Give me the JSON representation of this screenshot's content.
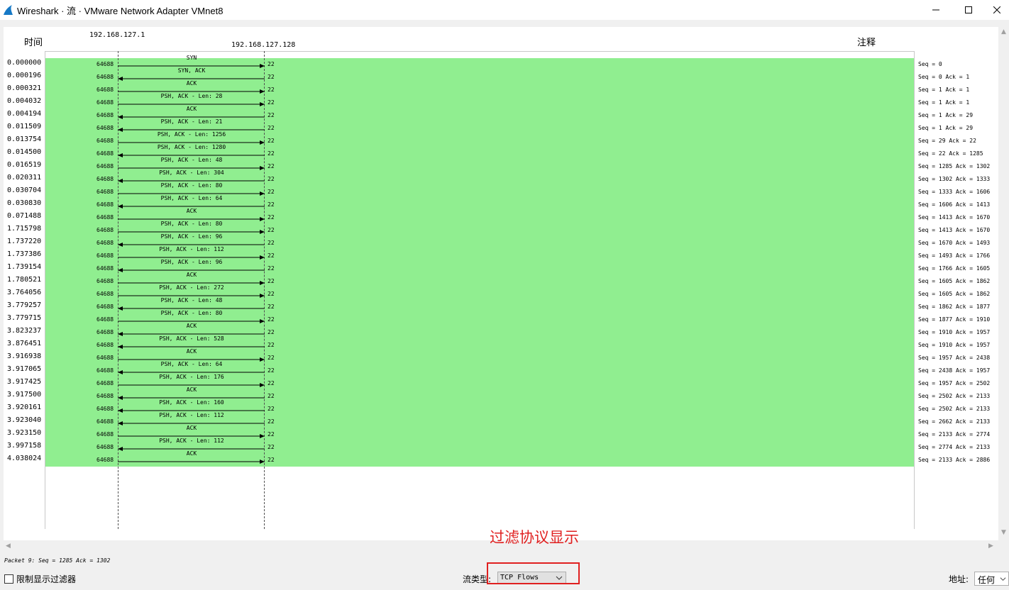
{
  "window": {
    "title": "Wireshark · 流 · VMware Network Adapter VMnet8",
    "icon": "wireshark-shark-fin-icon",
    "controls": [
      "minimize-icon",
      "maximize-icon",
      "close-icon"
    ]
  },
  "headers": {
    "time": "时间",
    "host1": "192.168.127.1",
    "host2": "192.168.127.128",
    "comment": "注释"
  },
  "colors": {
    "flow_fill": "#90ee90",
    "annotation": "#e02020"
  },
  "rows": [
    {
      "time": "0.000000",
      "src_port": "64688",
      "dst_port": "22",
      "label": "SYN",
      "direction": "right",
      "comment": "Seq = 0"
    },
    {
      "time": "0.000196",
      "src_port": "64688",
      "dst_port": "22",
      "label": "SYN, ACK",
      "direction": "left",
      "comment": "Seq = 0 Ack = 1"
    },
    {
      "time": "0.000321",
      "src_port": "64688",
      "dst_port": "22",
      "label": "ACK",
      "direction": "right",
      "comment": "Seq = 1 Ack = 1"
    },
    {
      "time": "0.004032",
      "src_port": "64688",
      "dst_port": "22",
      "label": "PSH, ACK - Len: 28",
      "direction": "right",
      "comment": "Seq = 1 Ack = 1"
    },
    {
      "time": "0.004194",
      "src_port": "64688",
      "dst_port": "22",
      "label": "ACK",
      "direction": "left",
      "comment": "Seq = 1 Ack = 29"
    },
    {
      "time": "0.011509",
      "src_port": "64688",
      "dst_port": "22",
      "label": "PSH, ACK - Len: 21",
      "direction": "left",
      "comment": "Seq = 1 Ack = 29"
    },
    {
      "time": "0.013754",
      "src_port": "64688",
      "dst_port": "22",
      "label": "PSH, ACK - Len: 1256",
      "direction": "right",
      "comment": "Seq = 29 Ack = 22"
    },
    {
      "time": "0.014500",
      "src_port": "64688",
      "dst_port": "22",
      "label": "PSH, ACK - Len: 1280",
      "direction": "left",
      "comment": "Seq = 22 Ack = 1285"
    },
    {
      "time": "0.016519",
      "src_port": "64688",
      "dst_port": "22",
      "label": "PSH, ACK - Len: 48",
      "direction": "right",
      "comment": "Seq = 1285 Ack = 1302"
    },
    {
      "time": "0.020311",
      "src_port": "64688",
      "dst_port": "22",
      "label": "PSH, ACK - Len: 304",
      "direction": "left",
      "comment": "Seq = 1302 Ack = 1333"
    },
    {
      "time": "0.030704",
      "src_port": "64688",
      "dst_port": "22",
      "label": "PSH, ACK - Len: 80",
      "direction": "right",
      "comment": "Seq = 1333 Ack = 1606"
    },
    {
      "time": "0.030830",
      "src_port": "64688",
      "dst_port": "22",
      "label": "PSH, ACK - Len: 64",
      "direction": "left",
      "comment": "Seq = 1606 Ack = 1413"
    },
    {
      "time": "0.071488",
      "src_port": "64688",
      "dst_port": "22",
      "label": "ACK",
      "direction": "right",
      "comment": "Seq = 1413 Ack = 1670"
    },
    {
      "time": "1.715798",
      "src_port": "64688",
      "dst_port": "22",
      "label": "PSH, ACK - Len: 80",
      "direction": "right",
      "comment": "Seq = 1413 Ack = 1670"
    },
    {
      "time": "1.737220",
      "src_port": "64688",
      "dst_port": "22",
      "label": "PSH, ACK - Len: 96",
      "direction": "left",
      "comment": "Seq = 1670 Ack = 1493"
    },
    {
      "time": "1.737386",
      "src_port": "64688",
      "dst_port": "22",
      "label": "PSH, ACK - Len: 112",
      "direction": "right",
      "comment": "Seq = 1493 Ack = 1766"
    },
    {
      "time": "1.739154",
      "src_port": "64688",
      "dst_port": "22",
      "label": "PSH, ACK - Len: 96",
      "direction": "left",
      "comment": "Seq = 1766 Ack = 1605"
    },
    {
      "time": "1.780521",
      "src_port": "64688",
      "dst_port": "22",
      "label": "ACK",
      "direction": "right",
      "comment": "Seq = 1605 Ack = 1862"
    },
    {
      "time": "3.764056",
      "src_port": "64688",
      "dst_port": "22",
      "label": "PSH, ACK - Len: 272",
      "direction": "right",
      "comment": "Seq = 1605 Ack = 1862"
    },
    {
      "time": "3.779257",
      "src_port": "64688",
      "dst_port": "22",
      "label": "PSH, ACK - Len: 48",
      "direction": "left",
      "comment": "Seq = 1862 Ack = 1877"
    },
    {
      "time": "3.779715",
      "src_port": "64688",
      "dst_port": "22",
      "label": "PSH, ACK - Len: 80",
      "direction": "right",
      "comment": "Seq = 1877 Ack = 1910"
    },
    {
      "time": "3.823237",
      "src_port": "64688",
      "dst_port": "22",
      "label": "ACK",
      "direction": "left",
      "comment": "Seq = 1910 Ack = 1957"
    },
    {
      "time": "3.876451",
      "src_port": "64688",
      "dst_port": "22",
      "label": "PSH, ACK - Len: 528",
      "direction": "left",
      "comment": "Seq = 1910 Ack = 1957"
    },
    {
      "time": "3.916938",
      "src_port": "64688",
      "dst_port": "22",
      "label": "ACK",
      "direction": "right",
      "comment": "Seq = 1957 Ack = 2438"
    },
    {
      "time": "3.917065",
      "src_port": "64688",
      "dst_port": "22",
      "label": "PSH, ACK - Len: 64",
      "direction": "left",
      "comment": "Seq = 2438 Ack = 1957"
    },
    {
      "time": "3.917425",
      "src_port": "64688",
      "dst_port": "22",
      "label": "PSH, ACK - Len: 176",
      "direction": "right",
      "comment": "Seq = 1957 Ack = 2502"
    },
    {
      "time": "3.917500",
      "src_port": "64688",
      "dst_port": "22",
      "label": "ACK",
      "direction": "left",
      "comment": "Seq = 2502 Ack = 2133"
    },
    {
      "time": "3.920161",
      "src_port": "64688",
      "dst_port": "22",
      "label": "PSH, ACK - Len: 160",
      "direction": "left",
      "comment": "Seq = 2502 Ack = 2133"
    },
    {
      "time": "3.923040",
      "src_port": "64688",
      "dst_port": "22",
      "label": "PSH, ACK - Len: 112",
      "direction": "left",
      "comment": "Seq = 2662 Ack = 2133"
    },
    {
      "time": "3.923150",
      "src_port": "64688",
      "dst_port": "22",
      "label": "ACK",
      "direction": "right",
      "comment": "Seq = 2133 Ack = 2774"
    },
    {
      "time": "3.997158",
      "src_port": "64688",
      "dst_port": "22",
      "label": "PSH, ACK - Len: 112",
      "direction": "left",
      "comment": "Seq = 2774 Ack = 2133"
    },
    {
      "time": "4.038024",
      "src_port": "64688",
      "dst_port": "22",
      "label": "ACK",
      "direction": "right",
      "comment": "Seq = 2133 Ack = 2886"
    }
  ],
  "status": "Packet 9: Seq = 1285 Ack = 1302",
  "limit_filter": {
    "label": "限制显示过滤器",
    "checked": false
  },
  "annotation": "过滤协议显示",
  "flow_type": {
    "label": "流类型:",
    "value": "TCP Flows"
  },
  "address": {
    "label": "地址:",
    "value": "任何"
  }
}
